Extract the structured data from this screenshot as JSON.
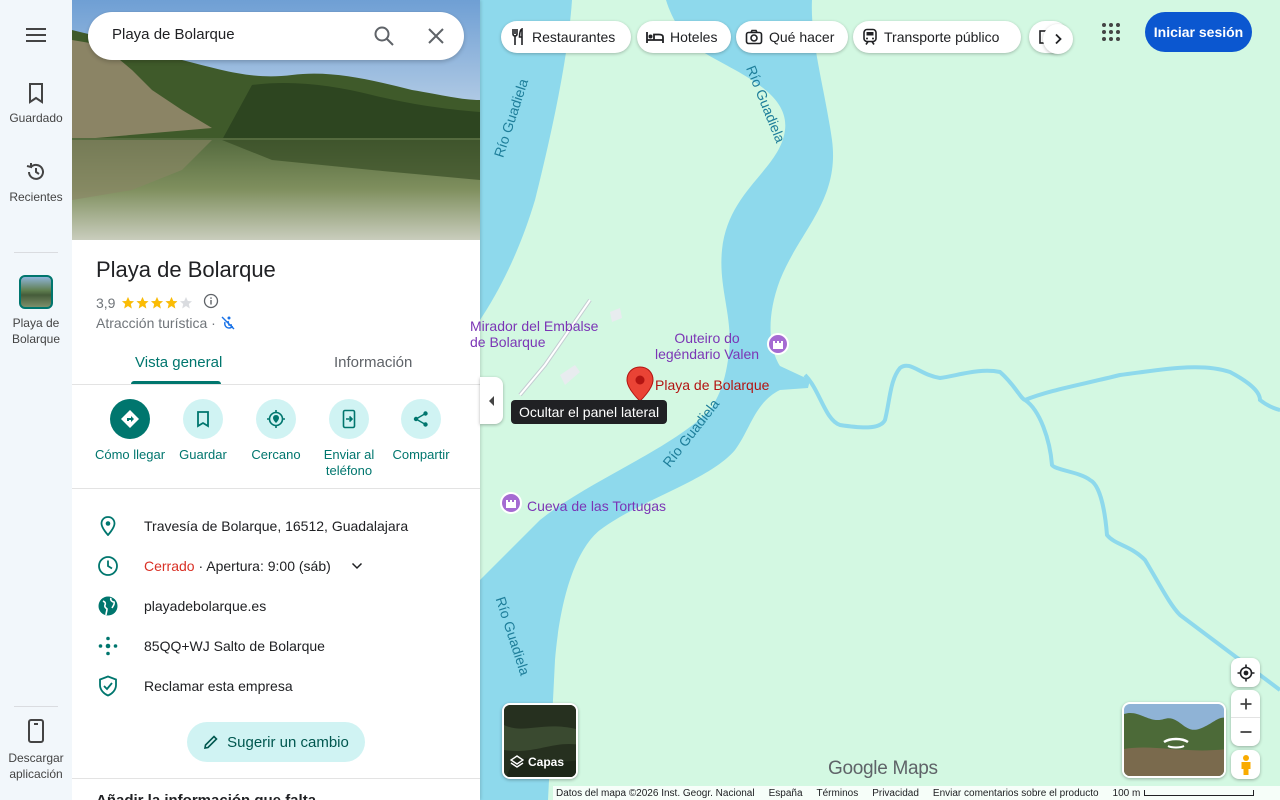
{
  "search": {
    "query": "Playa de Bolarque"
  },
  "rail": {
    "saved": "Guardado",
    "recents": "Recientes",
    "current_place": "Playa de Bolarque",
    "download": "Descargar aplicación"
  },
  "place": {
    "title": "Playa de Bolarque",
    "rating": "3,9",
    "stars_fraction": 0.78,
    "category": "Atracción turística ·",
    "tabs": [
      "Vista general",
      "Información"
    ],
    "actions": [
      {
        "label": "Cómo llegar",
        "icon": "directions-icon"
      },
      {
        "label": "Guardar",
        "icon": "bookmark-icon"
      },
      {
        "label": "Cercano",
        "icon": "nearby-icon"
      },
      {
        "label": "Enviar al teléfono",
        "icon": "send-to-phone-icon"
      },
      {
        "label": "Compartir",
        "icon": "share-icon"
      }
    ],
    "address": "Travesía de Bolarque, 16512, Guadalajara",
    "hours_status": "Cerrado",
    "hours_detail": " · Apertura: 9:00 (sáb)",
    "website": "playadebolarque.es",
    "plus_code": "85QQ+WJ Salto de Bolarque",
    "claim": "Reclamar esta empresa",
    "suggest": "Sugerir un cambio",
    "partial_heading": "Añadir la información que falta"
  },
  "map": {
    "tooltip": "Ocultar el panel lateral",
    "chips": [
      "Restaurantes",
      "Hoteles",
      "Qué hacer",
      "Transporte público"
    ],
    "signin": "Iniciar sesión",
    "labels": {
      "mirador": "Mirador del Embalse\nde Bolarque",
      "outeiro": "Outeiro do\nlegéndario Valen",
      "place": "Playa de Bolarque",
      "cueva": "Cueva de las Tortugas",
      "river": "Río Guadiela"
    },
    "layers": "Capas",
    "logo": "Google Maps",
    "footer": [
      "Datos del mapa ©2026 Inst. Geogr. Nacional",
      "España",
      "Términos",
      "Privacidad",
      "Enviar comentarios sobre el producto",
      "100 m"
    ]
  },
  "colors": {
    "accent": "#00766e",
    "signin": "#0b57d0",
    "water": "#8ed9ec",
    "land": "#d3f8e2",
    "closed": "#d93025"
  }
}
